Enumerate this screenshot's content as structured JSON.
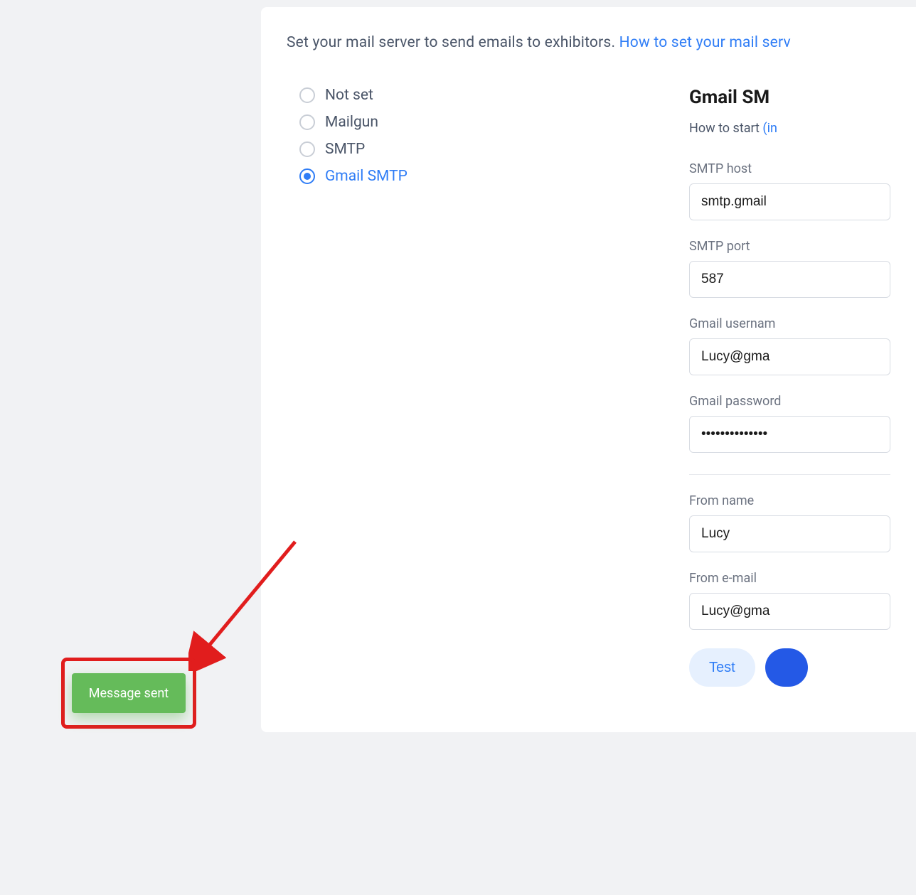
{
  "intro": {
    "text": "Set your mail server to send emails to exhibitors. ",
    "link": "How to set your mail serv"
  },
  "radios": [
    {
      "label": "Not set",
      "selected": false
    },
    {
      "label": "Mailgun",
      "selected": false
    },
    {
      "label": "SMTP",
      "selected": false
    },
    {
      "label": "Gmail SMTP",
      "selected": true
    }
  ],
  "form": {
    "title": "Gmail SM",
    "howto_text": "How to start ",
    "howto_link": "(in",
    "fields": {
      "smtp_host": {
        "label": "SMTP host",
        "value": "smtp.gmail"
      },
      "smtp_port": {
        "label": "SMTP port",
        "value": "587"
      },
      "gmail_username": {
        "label": "Gmail usernam",
        "value": "Lucy@gma"
      },
      "gmail_password": {
        "label": "Gmail password",
        "value": "••••••••••••••"
      },
      "from_name": {
        "label": "From name",
        "value": "Lucy"
      },
      "from_email": {
        "label": "From e-mail",
        "value": "Lucy@gma"
      }
    }
  },
  "buttons": {
    "test": "Test"
  },
  "toast": {
    "message": "Message sent"
  }
}
